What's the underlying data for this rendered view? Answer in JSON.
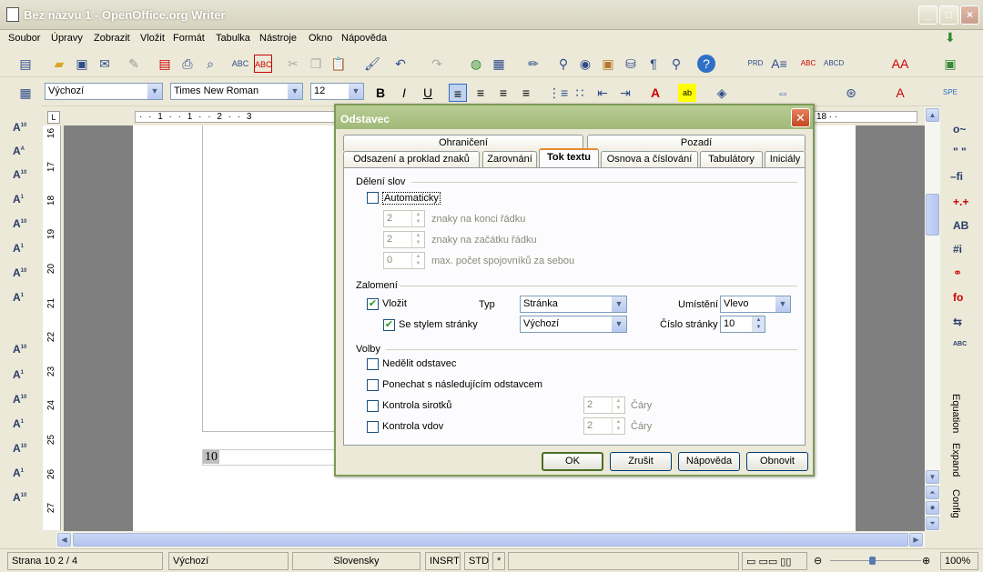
{
  "window": {
    "title": "Bez názvu 1 - OpenOffice.org Writer"
  },
  "menu": [
    "Soubor",
    "Úpravy",
    "Zobrazit",
    "Vložit",
    "Formát",
    "Tabulka",
    "Nástroje",
    "Okno",
    "Nápověda"
  ],
  "format_toolbar": {
    "style": "Výchozí",
    "font": "Times New Roman",
    "size": "12"
  },
  "ruler": {
    "marks": "· · 1 · · 1 · · 2 · · 3",
    "end": "18 · ·"
  },
  "vruler_numbers": [
    "16",
    "17",
    "18",
    "19",
    "20",
    "21",
    "22",
    "23",
    "24",
    "25",
    "26",
    "27"
  ],
  "doc": {
    "page_number_field": "10"
  },
  "right_panel": {
    "labels": [
      "Equation",
      "Expand",
      "Config"
    ]
  },
  "status": {
    "page": "Strana 10   2 / 4",
    "style": "Výchozí",
    "language": "Slovensky",
    "insert": "INSRT",
    "select": "STD",
    "modified": "*",
    "zoom": "100%"
  },
  "dialog": {
    "title": "Odstavec",
    "tabs_top": [
      "Ohraničení",
      "Pozadí"
    ],
    "tabs_bottom": [
      "Odsazení a proklad znaků",
      "Zarovnání",
      "Tok textu",
      "Osnova a číslování",
      "Tabulátory",
      "Iniciály"
    ],
    "active_tab": "Tok textu",
    "hyphenation": {
      "heading": "Dělení slov",
      "automatic_label": "Automaticky",
      "end_value": "2",
      "end_label": "znaky na konci řádku",
      "start_value": "2",
      "start_label": "znaky na začátku řádku",
      "max_value": "0",
      "max_label": "max. počet spojovníků za sebou"
    },
    "breaks": {
      "heading": "Zalomení",
      "insert_label": "Vložit",
      "type_label": "Typ",
      "type_value": "Stránka",
      "position_label": "Umístění",
      "position_value": "Vlevo",
      "with_style_label": "Se stylem stránky",
      "style_value": "Výchozí",
      "page_number_label": "Číslo stránky",
      "page_number_value": "10"
    },
    "options": {
      "heading": "Volby",
      "dont_split": "Nedělit odstavec",
      "keep_next": "Ponechat s následujícím odstavcem",
      "orphan": "Kontrola sirotků",
      "orphan_value": "2",
      "orphan_unit": "Čáry",
      "widow": "Kontrola vdov",
      "widow_value": "2",
      "widow_unit": "Čáry"
    },
    "buttons": {
      "ok": "OK",
      "cancel": "Zrušit",
      "help": "Nápověda",
      "reset": "Obnovit"
    }
  }
}
